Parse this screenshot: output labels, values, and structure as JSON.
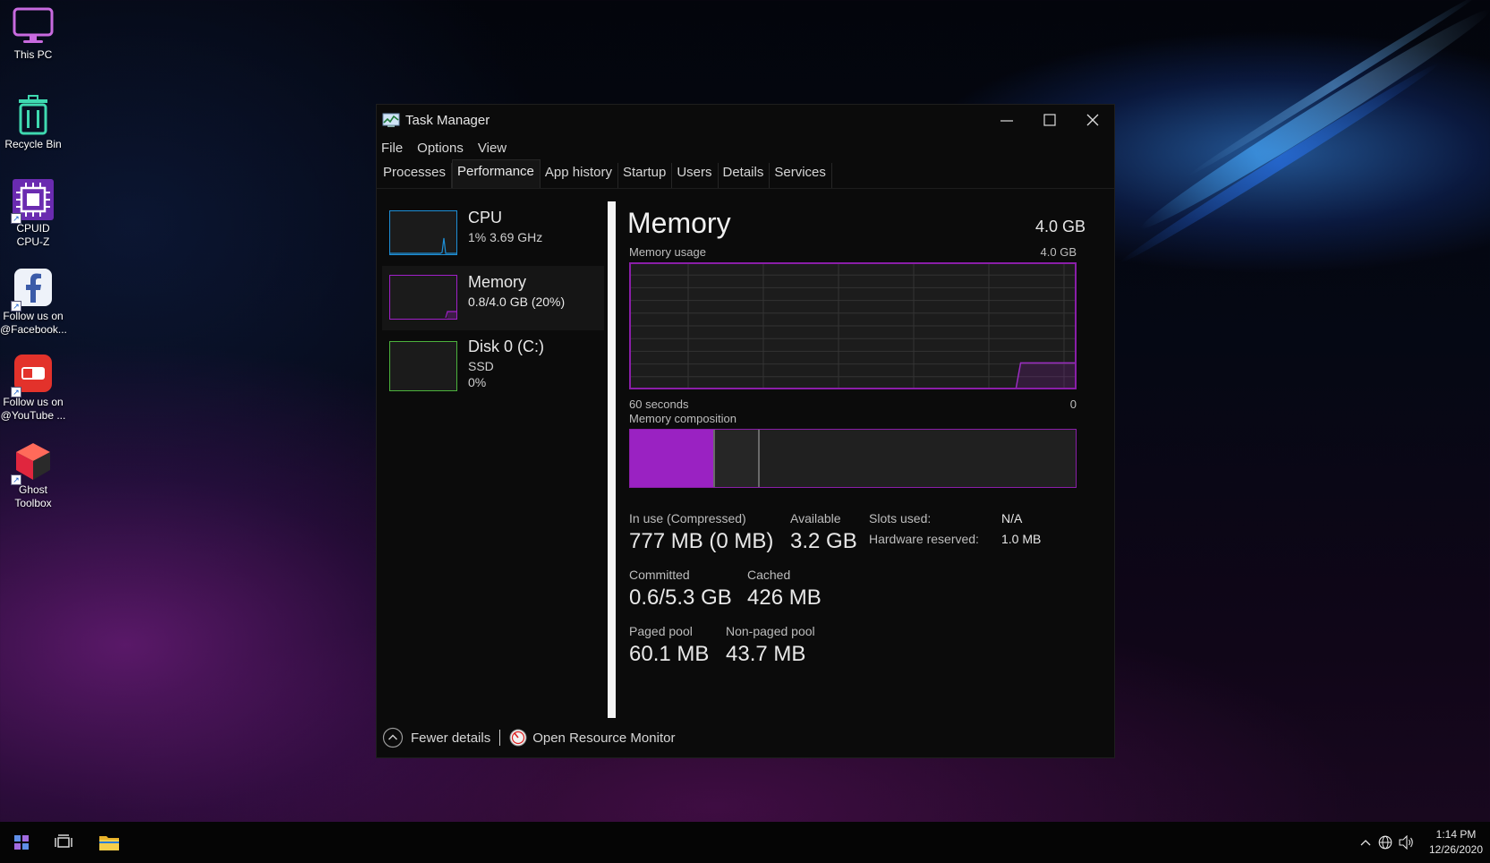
{
  "desktop": {
    "icons": [
      {
        "label_line1": "This PC",
        "label_line2": ""
      },
      {
        "label_line1": "Recycle Bin",
        "label_line2": ""
      },
      {
        "label_line1": "CPUID",
        "label_line2": "CPU-Z"
      },
      {
        "label_line1": "Follow us on",
        "label_line2": "@Facebook..."
      },
      {
        "label_line1": "Follow us on",
        "label_line2": "@YouTube ..."
      },
      {
        "label_line1": "Ghost",
        "label_line2": "Toolbox"
      }
    ]
  },
  "window": {
    "title": "Task Manager",
    "menu": [
      "File",
      "Options",
      "View"
    ],
    "tabs": [
      "Processes",
      "Performance",
      "App history",
      "Startup",
      "Users",
      "Details",
      "Services"
    ],
    "active_tab": "Performance"
  },
  "sidebar": {
    "items": [
      {
        "name": "CPU",
        "sub1": "1%  3.69 GHz",
        "sub2": "",
        "color": "#1e8fd6",
        "usage_percent": 1
      },
      {
        "name": "Memory",
        "sub1": "0.8/4.0 GB (20%)",
        "sub2": "",
        "color": "#a020c8",
        "usage_percent": 20
      },
      {
        "name": "Disk 0 (C:)",
        "sub1": "SSD",
        "sub2": "0%",
        "color": "#4cb33c",
        "usage_percent": 0
      }
    ],
    "selected": "Memory"
  },
  "memory": {
    "title": "Memory",
    "total": "4.0 GB",
    "usage_label": "Memory usage",
    "usage_max": "4.0 GB",
    "time_left": "60 seconds",
    "time_right": "0",
    "composition_label": "Memory composition",
    "composition": {
      "in_use_fraction": 0.19,
      "modified_fraction": 0.01,
      "standby_fraction": 0.1
    },
    "usage_recent_percent": 20,
    "accent": "#a020c8",
    "stats": {
      "in_use_label": "In use (Compressed)",
      "in_use_value": "777 MB (0 MB)",
      "available_label": "Available",
      "available_value": "3.2 GB",
      "committed_label": "Committed",
      "committed_value": "0.6/5.3 GB",
      "cached_label": "Cached",
      "cached_value": "426 MB",
      "paged_label": "Paged pool",
      "paged_value": "60.1 MB",
      "nonpaged_label": "Non-paged pool",
      "nonpaged_value": "43.7 MB"
    },
    "kv": {
      "slots_label": "Slots used:",
      "slots_value": "N/A",
      "hw_label": "Hardware reserved:",
      "hw_value": "1.0 MB"
    }
  },
  "footer": {
    "fewer_details": "Fewer details",
    "resource_monitor": "Open Resource Monitor"
  },
  "taskbar": {
    "time": "1:14 PM",
    "date": "12/26/2020"
  }
}
